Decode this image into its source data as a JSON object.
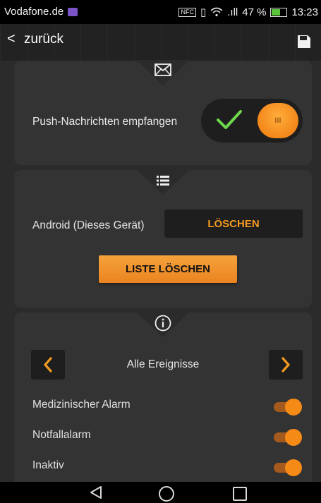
{
  "status_bar": {
    "carrier": "Vodafone.de",
    "nfc": "NFC",
    "signal": ".ıll",
    "battery_percent": "47 %",
    "time": "13:23"
  },
  "top_bar": {
    "back_label": "zurück",
    "back_icon": "chevron-left-icon",
    "save_icon": "floppy-disk-icon"
  },
  "push_card": {
    "icon": "envelope-icon",
    "label": "Push-Nachrichten empfangen",
    "toggle_on": true,
    "toggle_knob_text": "III"
  },
  "list_card": {
    "icon": "list-icon",
    "device_label": "Android (Dieses Gerät)",
    "delete_label": "LÖSCHEN",
    "clear_list_label": "LISTE LÖSCHEN"
  },
  "events_card": {
    "icon": "info-icon",
    "filter_label": "Alle Ereignisse",
    "events": [
      {
        "label": "Medizinischer Alarm",
        "enabled": true
      },
      {
        "label": "Notfallalarm",
        "enabled": true
      },
      {
        "label": "Inaktiv",
        "enabled": true
      }
    ]
  },
  "colors": {
    "accent": "#f58a17",
    "background": "#2b2b2b",
    "card": "#333333",
    "check": "#6fd84b"
  }
}
